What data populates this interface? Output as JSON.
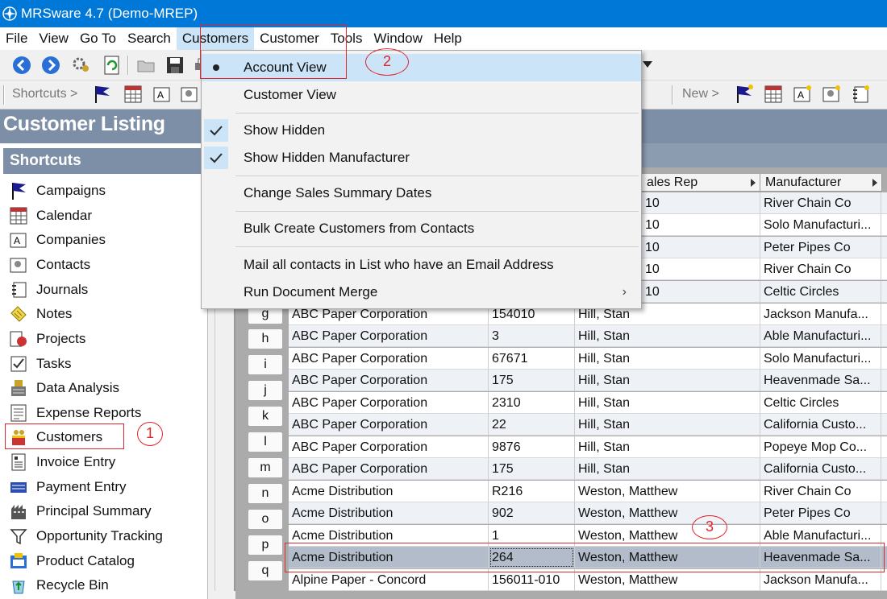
{
  "window": {
    "title": "MRSware 4.7 (Demo-MREP)"
  },
  "menubar": [
    "File",
    "View",
    "Go To",
    "Search",
    "Customers",
    "Customer",
    "Tools",
    "Window",
    "Help"
  ],
  "toolbar": {
    "shortcuts_label": "Shortcuts >",
    "new_label": "New >"
  },
  "listing": {
    "title": "Customer Listing"
  },
  "shortcuts": {
    "heading": "Shortcuts",
    "items": [
      {
        "label": "Campaigns",
        "icon": "flag-icon"
      },
      {
        "label": "Calendar",
        "icon": "calendar-icon"
      },
      {
        "label": "Companies",
        "icon": "companies-icon"
      },
      {
        "label": "Contacts",
        "icon": "contacts-icon"
      },
      {
        "label": "Journals",
        "icon": "journal-icon"
      },
      {
        "label": "Notes",
        "icon": "notes-icon"
      },
      {
        "label": "Projects",
        "icon": "projects-icon"
      },
      {
        "label": "Tasks",
        "icon": "tasks-icon"
      },
      {
        "label": "Data Analysis",
        "icon": "data-analysis-icon"
      },
      {
        "label": "Expense Reports",
        "icon": "expense-icon"
      },
      {
        "label": "Customers",
        "icon": "customers-icon"
      },
      {
        "label": "Invoice Entry",
        "icon": "invoice-icon"
      },
      {
        "label": "Payment Entry",
        "icon": "payment-icon"
      },
      {
        "label": "Principal Summary",
        "icon": "principal-icon"
      },
      {
        "label": "Opportunity Tracking",
        "icon": "funnel-icon"
      },
      {
        "label": "Product Catalog",
        "icon": "catalog-icon"
      },
      {
        "label": "Recycle Bin",
        "icon": "recycle-icon"
      }
    ]
  },
  "dropdown": {
    "items": [
      {
        "label": "Account View",
        "marker": "bullet"
      },
      {
        "label": "Customer View",
        "marker": ""
      },
      {
        "label": "Show Hidden",
        "marker": "check"
      },
      {
        "label": "Show Hidden Manufacturer",
        "marker": "check"
      },
      {
        "label": "Change Sales Summary Dates",
        "marker": ""
      },
      {
        "label": "Bulk Create Customers from Contacts",
        "marker": ""
      },
      {
        "label": "Mail all contacts in List who have an Email Address",
        "marker": ""
      },
      {
        "label": "Run Document Merge",
        "marker": "submenu"
      }
    ],
    "submenu_arrow": "›"
  },
  "grid": {
    "headers": {
      "sales_rep": "ales Rep",
      "manufacturer": "Manufacturer"
    },
    "hidden_rows": [
      {
        "rep": "10",
        "mfr": "River Chain Co"
      },
      {
        "rep": "10",
        "mfr": "Solo Manufacturi..."
      },
      {
        "rep": "10",
        "mfr": "Peter Pipes Co"
      },
      {
        "rep": "10",
        "mfr": "River Chain Co"
      },
      {
        "rep": "10",
        "mfr": "Celtic Circles"
      }
    ],
    "rows": [
      {
        "key": "g",
        "name": "ABC Paper Corporation",
        "num": "154010",
        "rep": "Hill, Stan",
        "mfr": "Jackson Manufa..."
      },
      {
        "key": "h",
        "name": "ABC Paper Corporation",
        "num": "3",
        "rep": "Hill, Stan",
        "mfr": "Able Manufacturi..."
      },
      {
        "key": "i",
        "name": "ABC Paper Corporation",
        "num": "67671",
        "rep": "Hill, Stan",
        "mfr": "Solo Manufacturi..."
      },
      {
        "key": "j",
        "name": "ABC Paper Corporation",
        "num": "175",
        "rep": "Hill, Stan",
        "mfr": "Heavenmade Sa..."
      },
      {
        "key": "k",
        "name": "ABC Paper Corporation",
        "num": "2310",
        "rep": "Hill, Stan",
        "mfr": "Celtic Circles"
      },
      {
        "key": "l",
        "name": "ABC Paper Corporation",
        "num": "22",
        "rep": "Hill, Stan",
        "mfr": "California Custo..."
      },
      {
        "key": "m",
        "name": "ABC Paper Corporation",
        "num": "9876",
        "rep": "Hill, Stan",
        "mfr": "Popeye Mop Co..."
      },
      {
        "key": "n",
        "name": "ABC Paper Corporation",
        "num": "175",
        "rep": "Hill, Stan",
        "mfr": "California Custo..."
      },
      {
        "key": "o",
        "name": "Acme Distribution",
        "num": "R216",
        "rep": "Weston, Matthew",
        "mfr": "River Chain Co"
      },
      {
        "key": "p",
        "name": "Acme Distribution",
        "num": "902",
        "rep": "Weston, Matthew",
        "mfr": "Peter Pipes Co"
      },
      {
        "key": "q",
        "name": "Acme Distribution",
        "num": "1",
        "rep": "Weston, Matthew",
        "mfr": "Able Manufacturi..."
      },
      {
        "key": "",
        "name": "Acme Distribution",
        "num": "264",
        "rep": "Weston, Matthew",
        "mfr": "Heavenmade Sa..."
      },
      {
        "key": "",
        "name": "Alpine Paper - Concord",
        "num": "156011-010",
        "rep": "Weston, Matthew",
        "mfr": "Jackson Manufa..."
      }
    ]
  },
  "annotations": [
    "1",
    "2",
    "3"
  ],
  "colors": {
    "titlebar": "#0078d7",
    "header_band": "#7d8fa6",
    "selection": "#b2bccb",
    "annotation": "#e0252e",
    "menu_highlight": "#cce4f7"
  }
}
